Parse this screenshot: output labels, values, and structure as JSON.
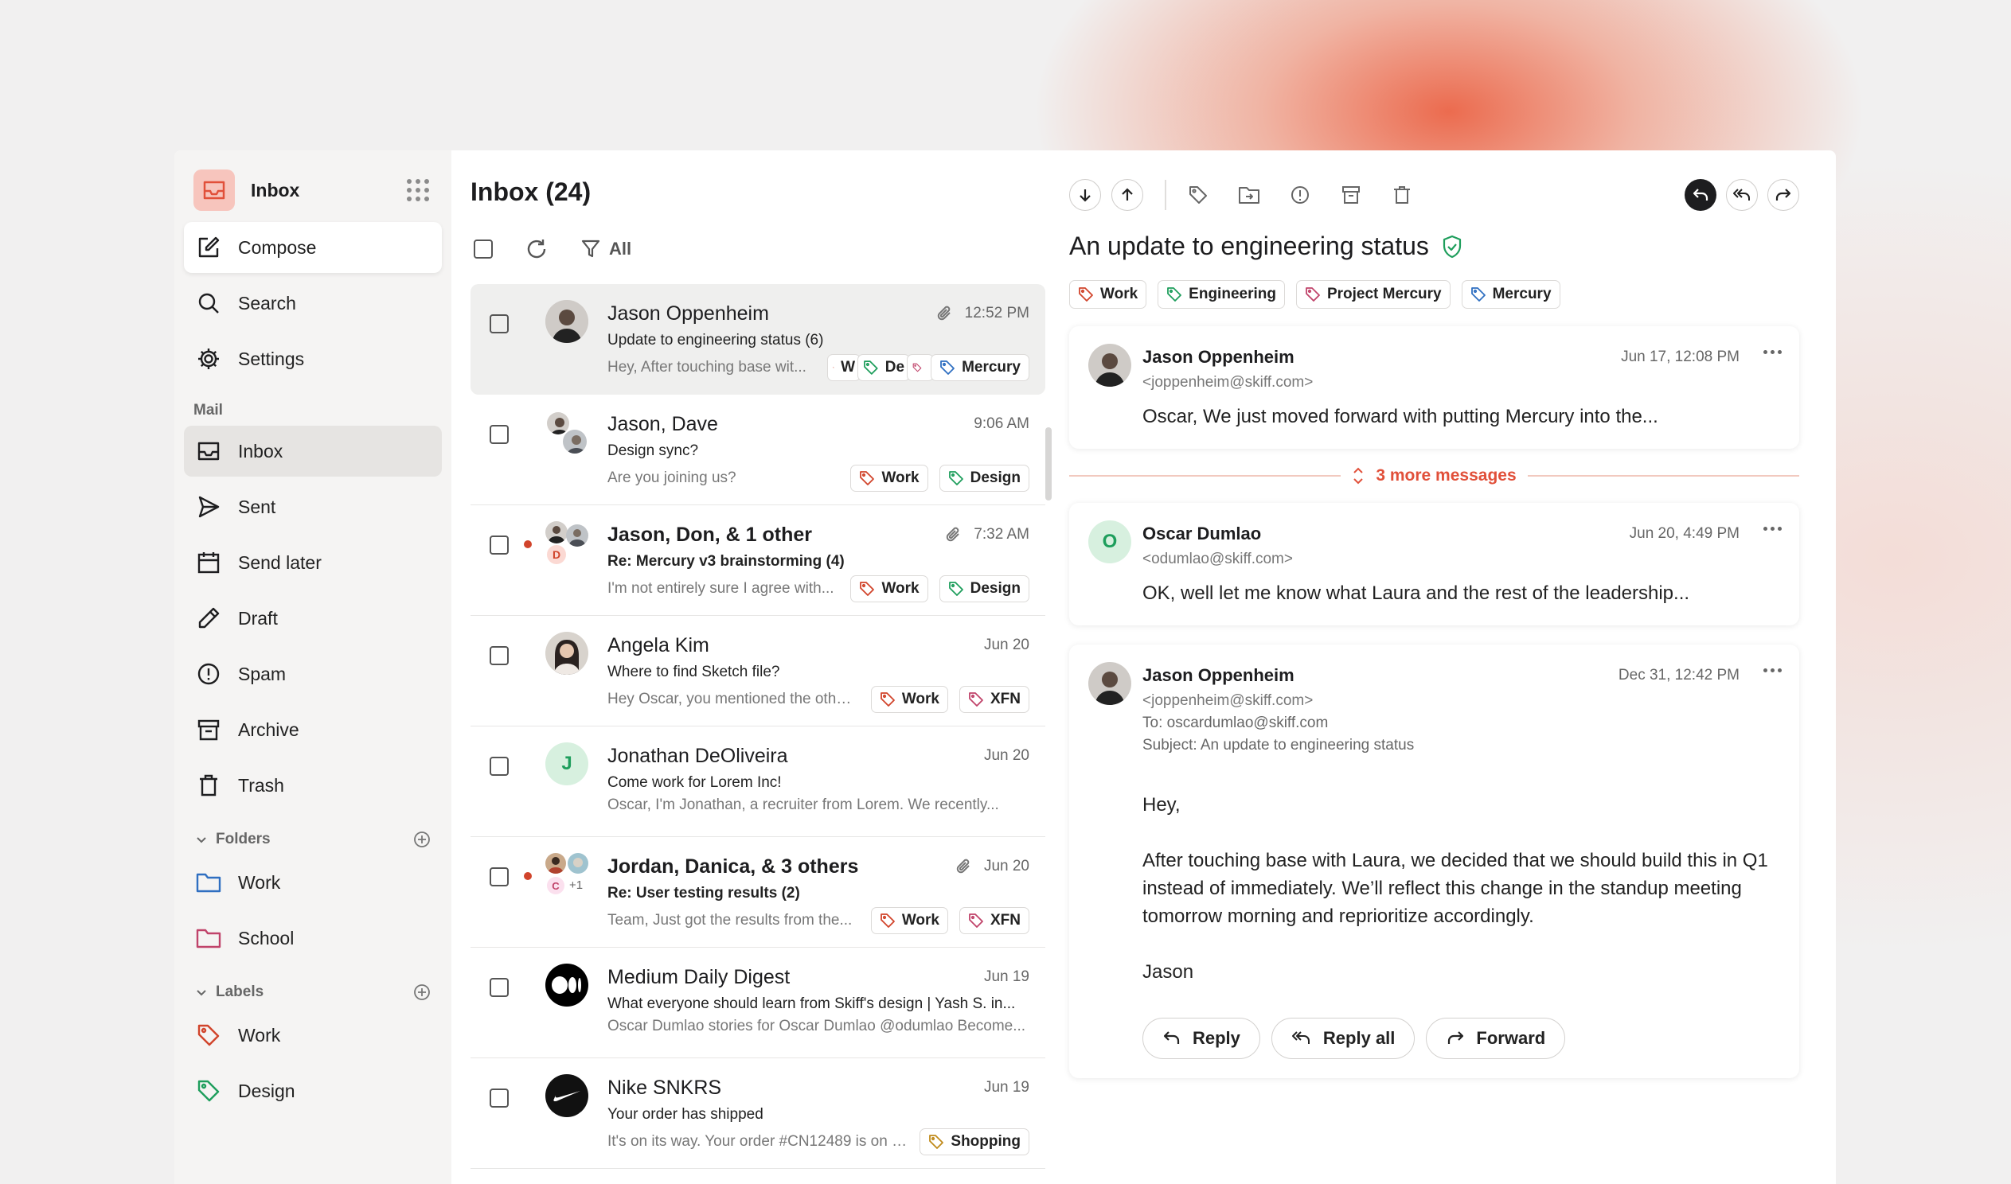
{
  "colors": {
    "accent": "#e1503a",
    "tag_red": "#d1442b",
    "tag_green": "#1e9e5c",
    "tag_blue": "#2f6fc1",
    "tag_orange": "#c08a1a",
    "tag_pink": "#c0436a",
    "folder_blue": "#2f6fc1",
    "folder_pink": "#c0436a"
  },
  "sidebar": {
    "app_title": "Inbox",
    "compose": "Compose",
    "search": "Search",
    "settings": "Settings",
    "mail_section": "Mail",
    "mail_items": [
      {
        "label": "Inbox",
        "icon": "inbox-icon"
      },
      {
        "label": "Sent",
        "icon": "send-icon"
      },
      {
        "label": "Send later",
        "icon": "calendar-icon"
      },
      {
        "label": "Draft",
        "icon": "pencil-icon"
      },
      {
        "label": "Spam",
        "icon": "alert-icon"
      },
      {
        "label": "Archive",
        "icon": "archive-icon"
      },
      {
        "label": "Trash",
        "icon": "trash-icon"
      }
    ],
    "folders_title": "Folders",
    "folders": [
      {
        "label": "Work"
      },
      {
        "label": "School"
      }
    ],
    "labels_title": "Labels",
    "labels": [
      {
        "label": "Work"
      },
      {
        "label": "Design"
      }
    ]
  },
  "list": {
    "title": "Inbox (24)",
    "filter": "All",
    "rows": [
      {
        "sender": "Jason Oppenheim",
        "time": "12:52 PM",
        "subject": "Update to engineering status (6)",
        "preview": "Hey, After touching base wit...",
        "tags": [
          "W",
          "De",
          "",
          "Mercury"
        ]
      },
      {
        "sender": "Jason, Dave",
        "time": "9:06 AM",
        "subject": "Design sync?",
        "preview": "Are you joining us?",
        "tags": [
          "Work",
          "Design"
        ]
      },
      {
        "sender": "Jason, Don, & 1 other",
        "time": "7:32 AM",
        "subject": "Re: Mercury v3 brainstorming (4)",
        "preview": "I'm not entirely sure I agree with...",
        "tags": [
          "Work",
          "Design"
        ],
        "avatar_letter": "D"
      },
      {
        "sender": "Angela Kim",
        "time": "Jun 20",
        "subject": "Where to find Sketch file?",
        "preview": "Hey Oscar, you mentioned the other...",
        "tags": [
          "Work",
          "XFN"
        ]
      },
      {
        "sender": "Jonathan DeOliveira",
        "time": "Jun 20",
        "subject": "Come work for Lorem Inc!",
        "preview": "Oscar, I'm Jonathan, a recruiter from Lorem. We recently...",
        "tags": [],
        "avatar_letter": "J"
      },
      {
        "sender": "Jordan, Danica, & 3 others",
        "time": "Jun 20",
        "subject": "Re: User testing results (2)",
        "preview": "Team, Just got the results from the...",
        "tags": [
          "Work",
          "XFN"
        ],
        "avatar_letter": "C",
        "avatar_more": "+1"
      },
      {
        "sender": "Medium Daily Digest",
        "time": "Jun 19",
        "subject": "What everyone should learn from Skiff's design | Yash S. in...",
        "preview": "Oscar Dumlao stories for Oscar Dumlao @odumlao Become...",
        "tags": []
      },
      {
        "sender": "Nike SNKRS",
        "time": "Jun 19",
        "subject": "Your order has shipped",
        "preview": "It's on its way. Your order #CN12489 is on it...",
        "tags": [
          "Shopping"
        ]
      }
    ]
  },
  "reader": {
    "title": "An update to engineering status",
    "tags": [
      "Work",
      "Engineering",
      "Project Mercury",
      "Mercury"
    ],
    "more_messages": "3 more messages",
    "messages": [
      {
        "name": "Jason Oppenheim",
        "email": "<joppenheim@skiff.com>",
        "date": "Jun 17, 12:08 PM",
        "snippet": "Oscar, We just moved forward with putting Mercury into the..."
      },
      {
        "name": "Oscar Dumlao",
        "email": "<odumlao@skiff.com>",
        "date": "Jun 20, 4:49 PM",
        "snippet": "OK, well let me know what Laura and the rest of the leadership...",
        "avatar_letter": "O"
      }
    ],
    "expanded": {
      "name": "Jason Oppenheim",
      "email": "<joppenheim@skiff.com>",
      "date": "Dec 31, 12:42 PM",
      "to": "To: oscardumlao@skiff.com",
      "subject": "Subject: An update to engineering status",
      "greeting": "Hey,",
      "body": "After touching base with Laura, we decided that we should build this in Q1 instead of immediately. We’ll reflect this change in the standup meeting tomorrow morning and reprioritize accordingly.",
      "signature": "Jason"
    },
    "actions": {
      "reply": "Reply",
      "reply_all": "Reply all",
      "forward": "Forward"
    }
  }
}
